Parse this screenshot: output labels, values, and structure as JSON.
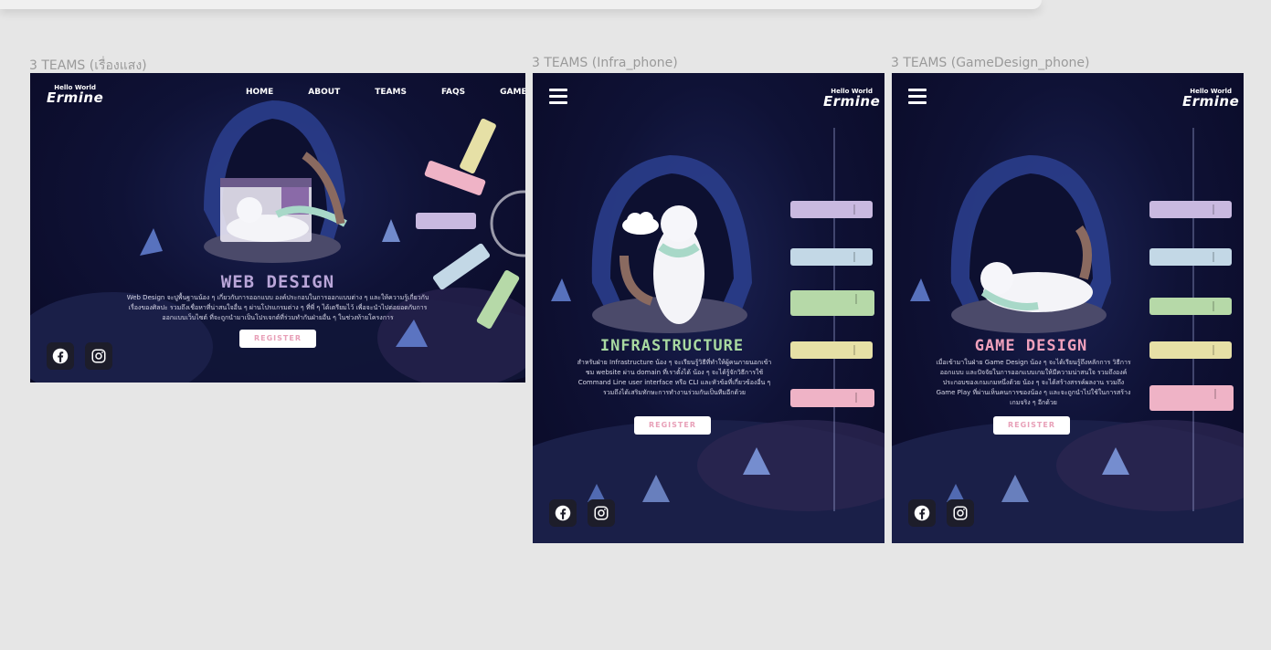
{
  "frames": [
    {
      "label": "3 TEAMS (เรื่องแสง)",
      "logo": {
        "small": "Hello World",
        "big": "Ermine"
      },
      "nav": [
        "HOME",
        "ABOUT",
        "TEAMS",
        "FAQS",
        "GAME"
      ],
      "title": "WEB DESIGN",
      "title_color": "#b9a5d8",
      "description": "Web Design จะปูพื้นฐานน้อง ๆ เกี่ยวกับการออกแบบ องค์ประกอบในการออกแบบต่าง ๆ และให้ความรู้เกี่ยวกับเรื่องของศิลปะ รวมถึงเชื่อหาที่น่าสนใจอื่น ๆ ผ่านโปรแกรมต่าง ๆ ที่พี่ ๆ ได้เตรียมไว้ เพื่อจะนำไปต่อยอดกับการออกแบบเว็บไซต์ ที่จะถูกนำมาเป็นโปรเจกต์ที่ร่วมทำกันฝ่ายอื่น ๆ ในช่วงท้ายโครงการ",
      "register": "REGISTER"
    },
    {
      "label": "3 TEAMS (Infra_phone)",
      "logo": {
        "small": "Hello World",
        "big": "Ermine"
      },
      "title": "INFRASTRUCTURE",
      "title_color": "#a8d9a0",
      "description": "สำหรับฝ่าย Infrastructure น้อง ๆ จะเรียนรู้วิธีที่ทำให้ผู้คนภายนอกเข้าชม website ผ่าน domain ที่เราตั้งได้ น้อง ๆ จะได้รู้จักวิธีการใช้ Command Line user interface หรือ CLI และหัวข้อที่เกี่ยวข้องอื่น ๆ รวมถึงได้เสริมทักษะการทำงานร่วมกันเป็นทีมอีกด้วย",
      "register": "REGISTER"
    },
    {
      "label": "3 TEAMS (GameDesign_phone)",
      "logo": {
        "small": "Hello World",
        "big": "Ermine"
      },
      "title": "GAME DESIGN",
      "title_color": "#f0a0bc",
      "description": "เมื่อเข้ามาในฝ่าย Game Design น้อง ๆ จะได้เรียนรู้ถึงหลักการ วิธีการออกแบบ และปัจจัยในการออกแบบเกมให้มีความน่าสนใจ รวมถึงองค์ประกอบของเกมเกมหนึ่งด้วย น้อง ๆ จะได้สร้างสรรค์ผลงาน รวมถึง Game Play ที่ผ่านเห็นคนการของน้อง ๆ และจะถูกนำไปใช้ในการสร้างเกมจริง ๆ อีกด้วย",
      "register": "REGISTER"
    }
  ],
  "colors": {
    "tag_purple": "#c9b9e0",
    "tag_blue": "#c3d8e6",
    "tag_green": "#b6d9a8",
    "tag_yellow": "#e6e0a6",
    "tag_pink": "#efb3c6"
  }
}
